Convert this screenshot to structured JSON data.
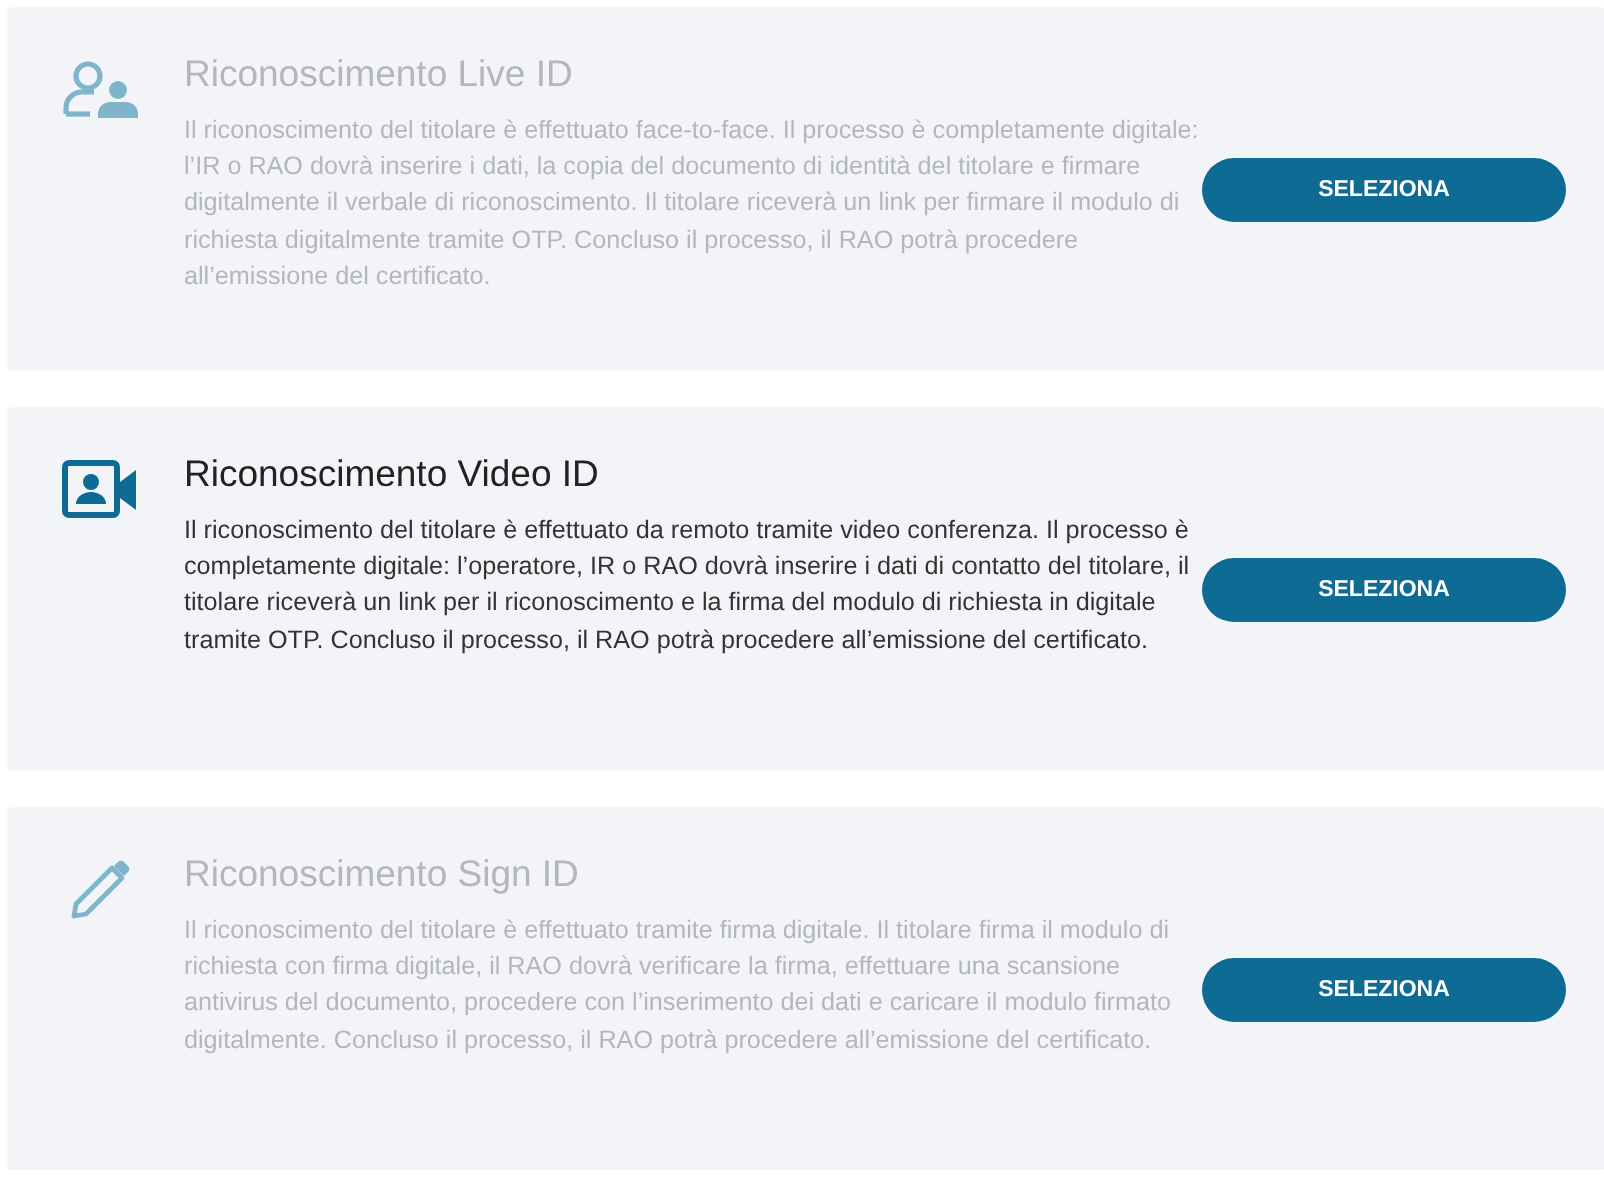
{
  "options": [
    {
      "kind": "person",
      "disabled": true,
      "title": "Riconoscimento Live ID",
      "description": "Il riconoscimento del titolare è effettuato face-to-face. Il processo è completamente digitale: l’IR o RAO dovrà inserire i dati, la copia del documento di identità del titolare e firmare digitalmente il verbale di riconoscimento. Il titolare riceverà un link per firmare il modulo di richiesta digitalmente tramite OTP. Concluso il processo, il RAO potrà procedere all’emissione del certificato.",
      "button": "SELEZIONA"
    },
    {
      "kind": "video",
      "disabled": false,
      "title": "Riconoscimento Video ID",
      "description": "Il riconoscimento del titolare è effettuato da remoto tramite video conferenza. Il processo è completamente digitale: l’operatore, IR o RAO dovrà inserire i dati di contatto del titolare, il titolare riceverà un link per il riconoscimento e la firma del modulo di richiesta in digitale tramite OTP. Concluso il processo, il RAO potrà procedere all’emissione del certificato.",
      "button": "SELEZIONA"
    },
    {
      "kind": "pencil",
      "disabled": true,
      "title": "Riconoscimento Sign ID",
      "description": "Il riconoscimento del titolare è effettuato tramite firma digitale. Il titolare firma il modulo di richiesta con firma digitale, il RAO dovrà verificare la firma, effettuare una scansione antivirus del documento, procedere con l’inserimento dei dati e caricare il modulo firmato digitalmente. Concluso il processo, il RAO potrà procedere all’emissione del certificato.",
      "button": "SELEZIONA"
    }
  ]
}
